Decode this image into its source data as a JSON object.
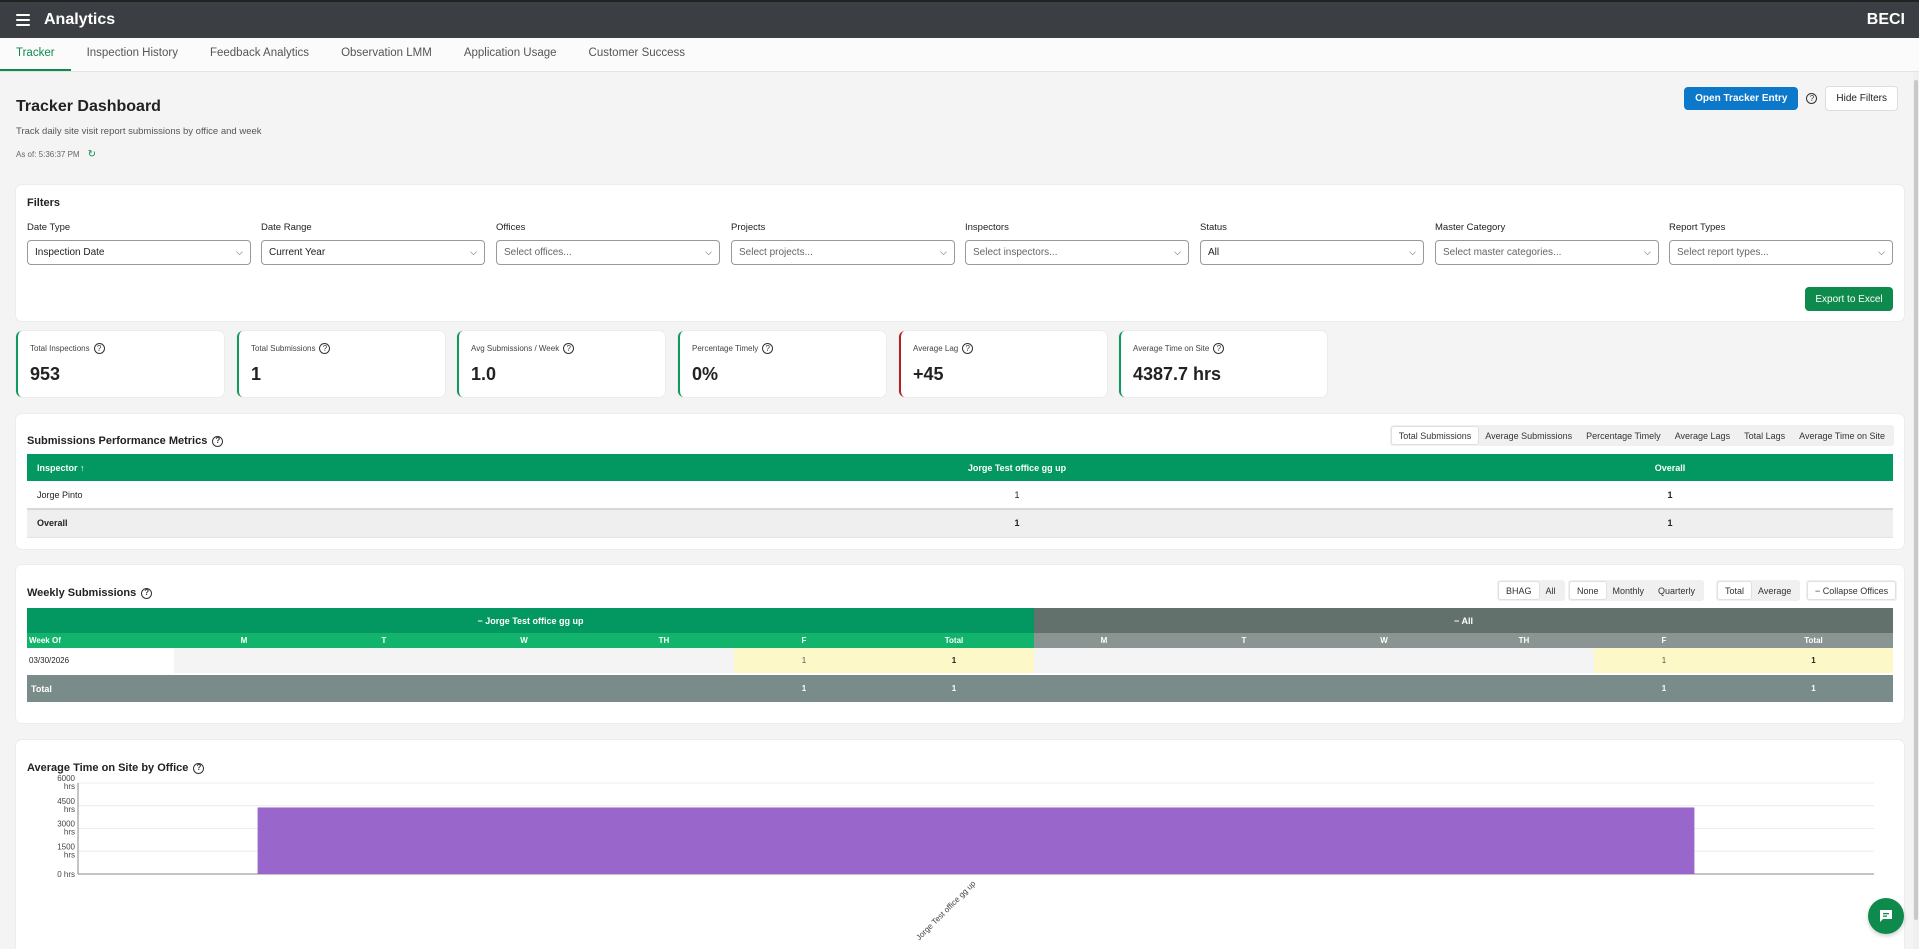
{
  "app": {
    "title": "Analytics",
    "brand": "BECI"
  },
  "tabs": [
    "Tracker",
    "Inspection History",
    "Feedback Analytics",
    "Observation LMM",
    "Application Usage",
    "Customer Success"
  ],
  "header": {
    "title": "Tracker Dashboard",
    "subtitle": "Track daily site visit report submissions by office and week",
    "as_of": "As of: 5:36:37 PM",
    "open_tracker": "Open Tracker Entry",
    "hide_filters": "Hide Filters"
  },
  "filters": {
    "title": "Filters",
    "export": "Export to Excel",
    "items": [
      {
        "label": "Date Type",
        "value": "Inspection Date",
        "placeholder": false
      },
      {
        "label": "Date Range",
        "value": "Current Year",
        "placeholder": false
      },
      {
        "label": "Offices",
        "value": "Select offices...",
        "placeholder": true
      },
      {
        "label": "Projects",
        "value": "Select projects...",
        "placeholder": true
      },
      {
        "label": "Inspectors",
        "value": "Select inspectors...",
        "placeholder": true
      },
      {
        "label": "Status",
        "value": "All",
        "placeholder": false
      },
      {
        "label": "Master Category",
        "value": "Select master categories...",
        "placeholder": true
      },
      {
        "label": "Report Types",
        "value": "Select report types...",
        "placeholder": true
      }
    ]
  },
  "kpis": [
    {
      "label": "Total Inspections",
      "value": "953",
      "accent": "#0e9a5a"
    },
    {
      "label": "Total Submissions",
      "value": "1",
      "accent": "#0e9a5a"
    },
    {
      "label": "Avg Submissions / Week",
      "value": "1.0",
      "accent": "#0e9a5a"
    },
    {
      "label": "Percentage Timely",
      "value": "0%",
      "accent": "#0e9a5a"
    },
    {
      "label": "Average Lag",
      "value": "+45",
      "accent": "#b22222"
    },
    {
      "label": "Average Time on Site",
      "value": "4387.7 hrs",
      "accent": "#0e9a5a"
    }
  ],
  "performance": {
    "title": "Submissions Performance Metrics",
    "metric_tabs": [
      "Total Submissions",
      "Average Submissions",
      "Percentage Timely",
      "Average Lags",
      "Total Lags",
      "Average Time on Site"
    ],
    "columns": [
      "Inspector ↑",
      "Jorge Test office gg up",
      "Overall"
    ],
    "rows": [
      [
        "Jorge Pinto",
        "1",
        "1"
      ]
    ],
    "overall": [
      "Overall",
      "1",
      "1"
    ]
  },
  "weekly": {
    "title": "Weekly Submissions",
    "toggles": {
      "a": [
        "BHAG",
        "All"
      ],
      "b": [
        "None",
        "Monthly",
        "Quarterly"
      ],
      "c": [
        "Total",
        "Average"
      ],
      "collapse": "− Collapse Offices"
    },
    "groups": [
      "−  Jorge Test office gg up",
      "−  All"
    ],
    "week_col": "Week Of",
    "days": [
      "M",
      "T",
      "W",
      "TH",
      "F",
      "Total"
    ],
    "rows": [
      {
        "week": "03/30/2026",
        "g1": [
          "",
          "",
          "",
          "",
          "1",
          "1"
        ],
        "g2": [
          "",
          "",
          "",
          "",
          "1",
          "1"
        ]
      }
    ],
    "total": {
      "label": "Total",
      "g1": [
        "",
        "",
        "",
        "",
        "1",
        "1"
      ],
      "g2": [
        "",
        "",
        "",
        "",
        "1",
        "1"
      ]
    }
  },
  "chart_data": {
    "type": "bar",
    "title": "Average Time on Site by Office",
    "categories": [
      "Jorge Test office gg up"
    ],
    "values": [
      4387.7
    ],
    "ylim": [
      0,
      6000
    ],
    "yticks": [
      "0 hrs",
      "1500 hrs",
      "3000 hrs",
      "4500 hrs",
      "6000 hrs"
    ],
    "yticks_v": [
      0,
      1500,
      3000,
      4500,
      6000
    ],
    "color": "#9966cc",
    "grid": true
  }
}
